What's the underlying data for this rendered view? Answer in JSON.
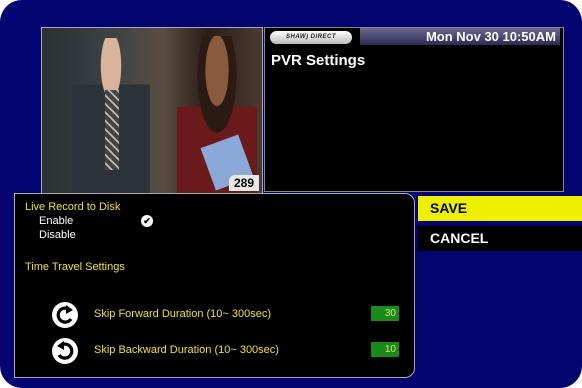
{
  "video": {
    "channel_number": "289"
  },
  "info_panel": {
    "brand": "SHAW) DIRECT",
    "datetime": "Mon Nov 30 10:50AM",
    "title": "PVR Settings"
  },
  "menu": {
    "live_record": {
      "label": "Live Record to Disk",
      "options": [
        "Enable",
        "Disable"
      ],
      "selected": "Enable"
    },
    "time_travel": {
      "label": "Time Travel Settings",
      "skip_forward": {
        "label": "Skip Forward Duration (10~ 300sec)",
        "value": "30",
        "icon": "skip-forward-icon"
      },
      "skip_backward": {
        "label": "Skip Backward Duration (10~ 300sec)",
        "value": "10",
        "icon": "skip-backward-icon"
      }
    }
  },
  "actions": {
    "save_label": "SAVE",
    "cancel_label": "CANCEL"
  },
  "colors": {
    "background": "#040470",
    "highlight": "#eef000",
    "section_text": "#f0e034",
    "value_box": "#1a8a1a"
  }
}
